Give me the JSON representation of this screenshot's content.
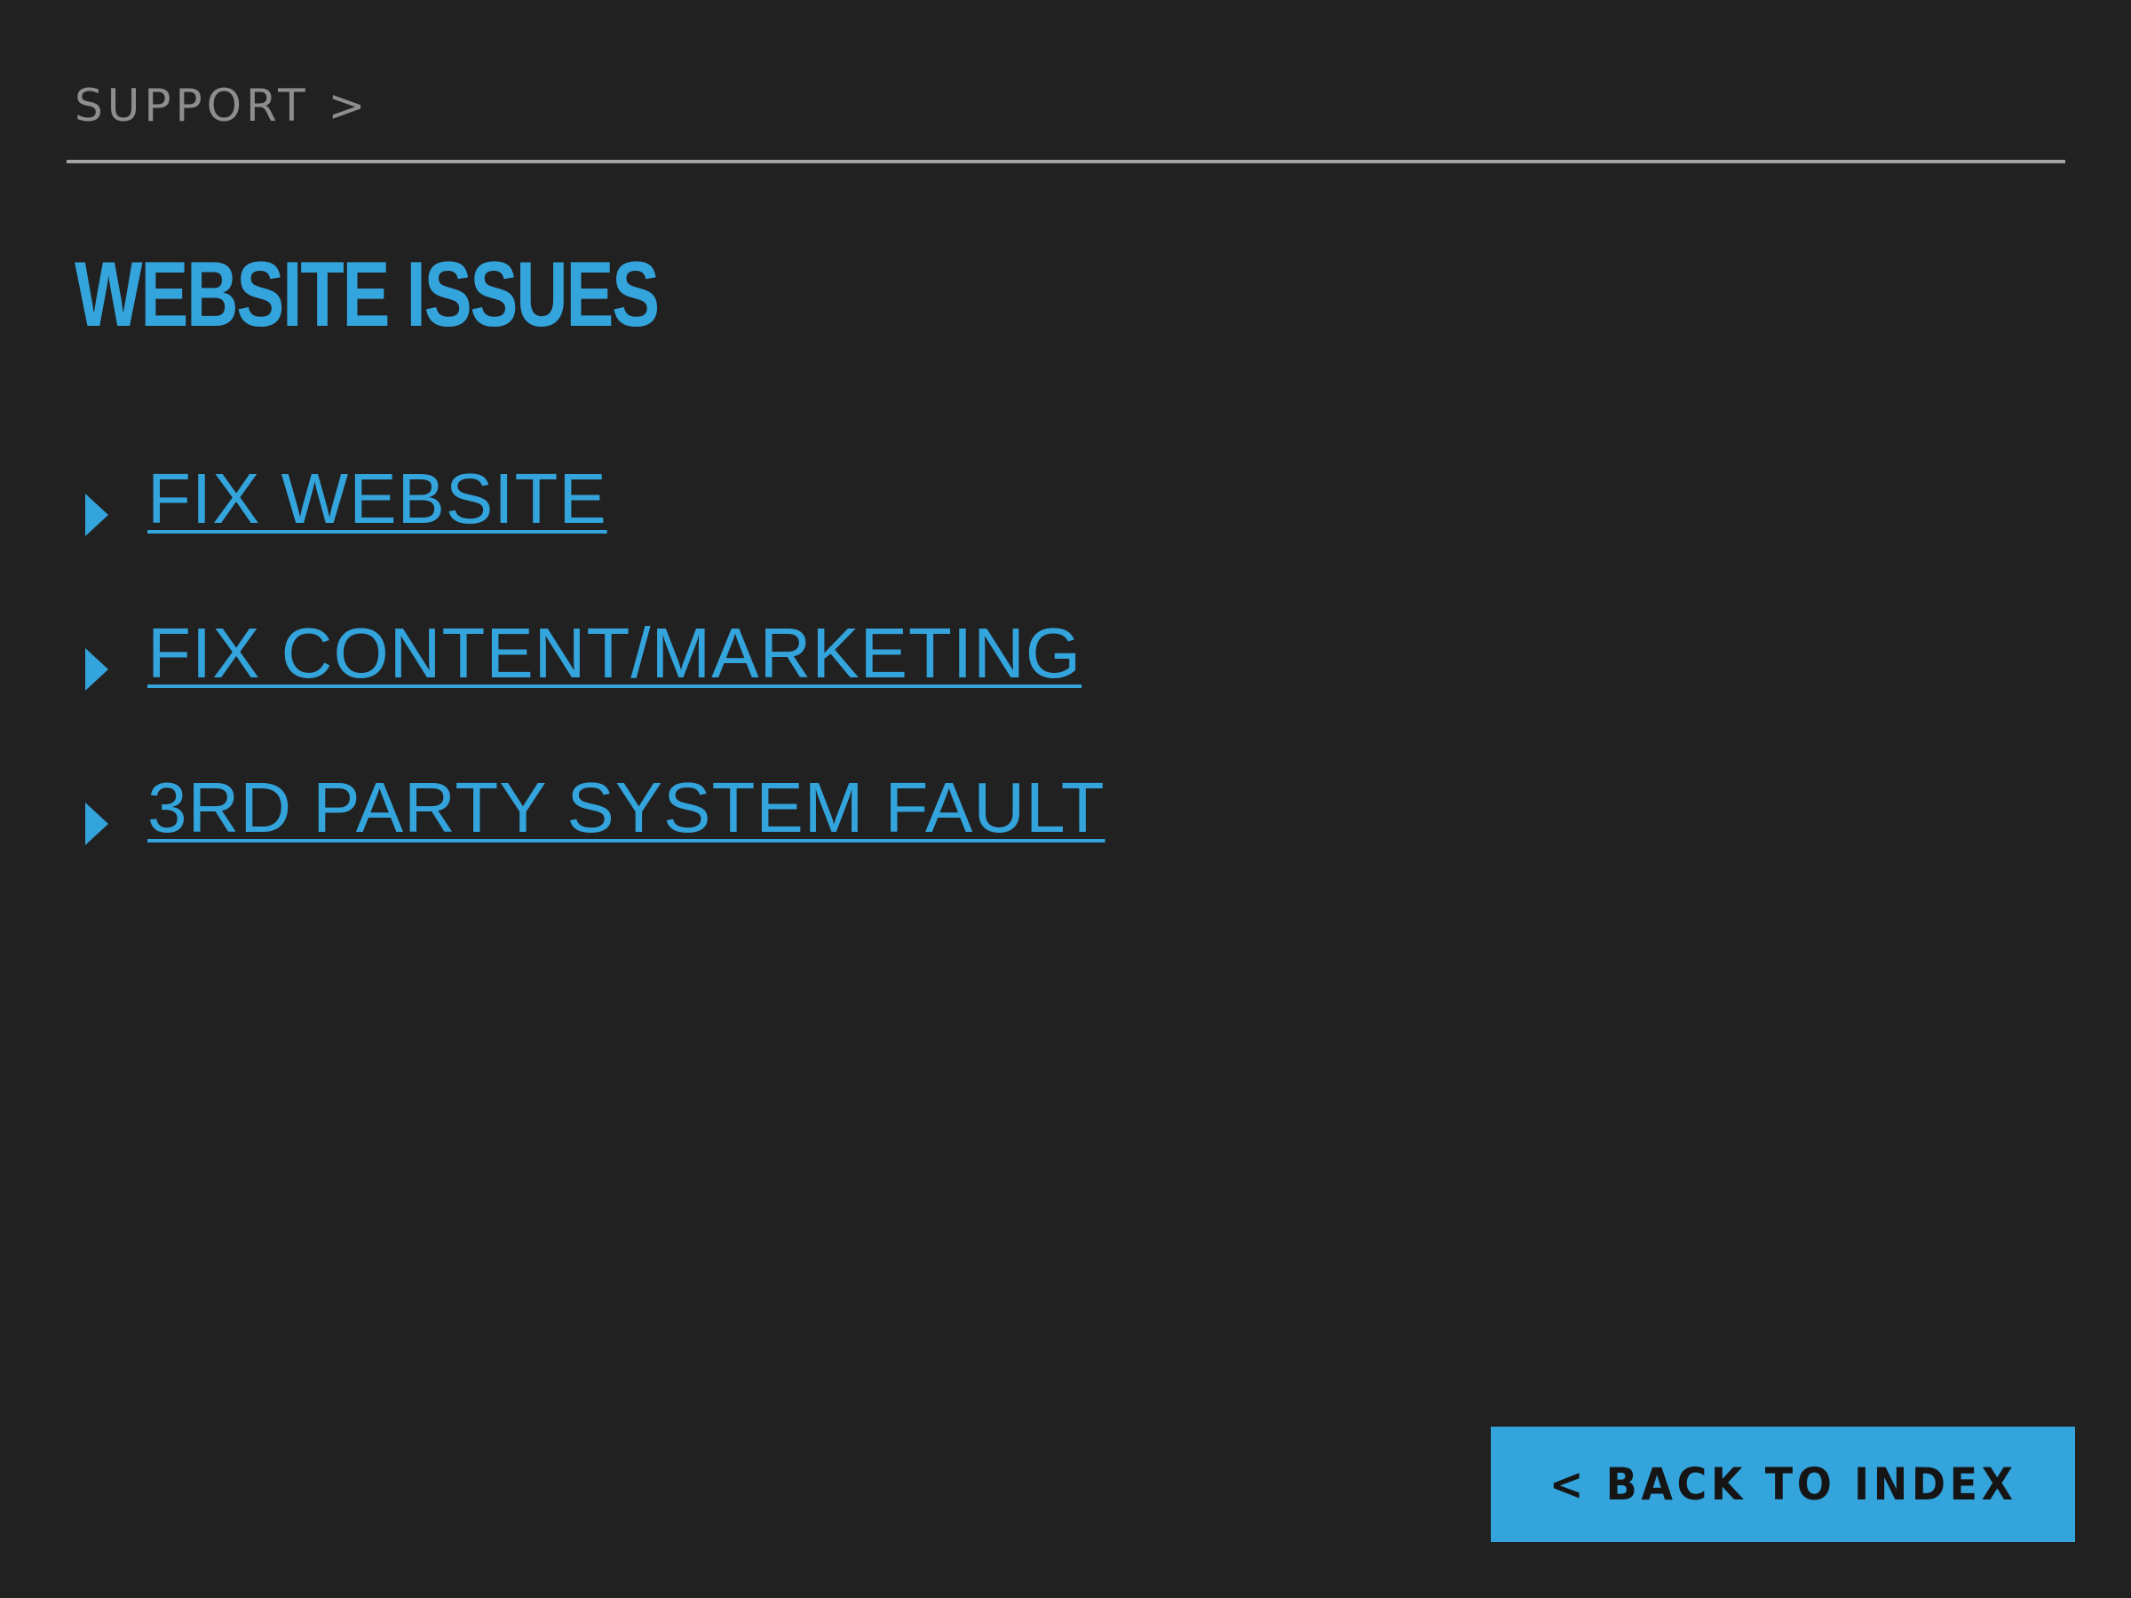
{
  "header": {
    "breadcrumb": "SUPPORT >"
  },
  "main": {
    "title": "WEBSITE ISSUES",
    "links": [
      {
        "label": "FIX WEBSITE",
        "icon": "triangle-right-icon"
      },
      {
        "label": "FIX CONTENT/MARKETING",
        "icon": "triangle-right-icon"
      },
      {
        "label": "3RD PARTY SYSTEM FAULT",
        "icon": "triangle-right-icon"
      }
    ]
  },
  "footer": {
    "back_button_label": "< BACK TO INDEX"
  },
  "colors": {
    "background": "#212121",
    "accent": "#34a4dc",
    "breadcrumb_text": "#8e8e8e",
    "divider": "#a3a3a3",
    "button_text": "#151515"
  }
}
